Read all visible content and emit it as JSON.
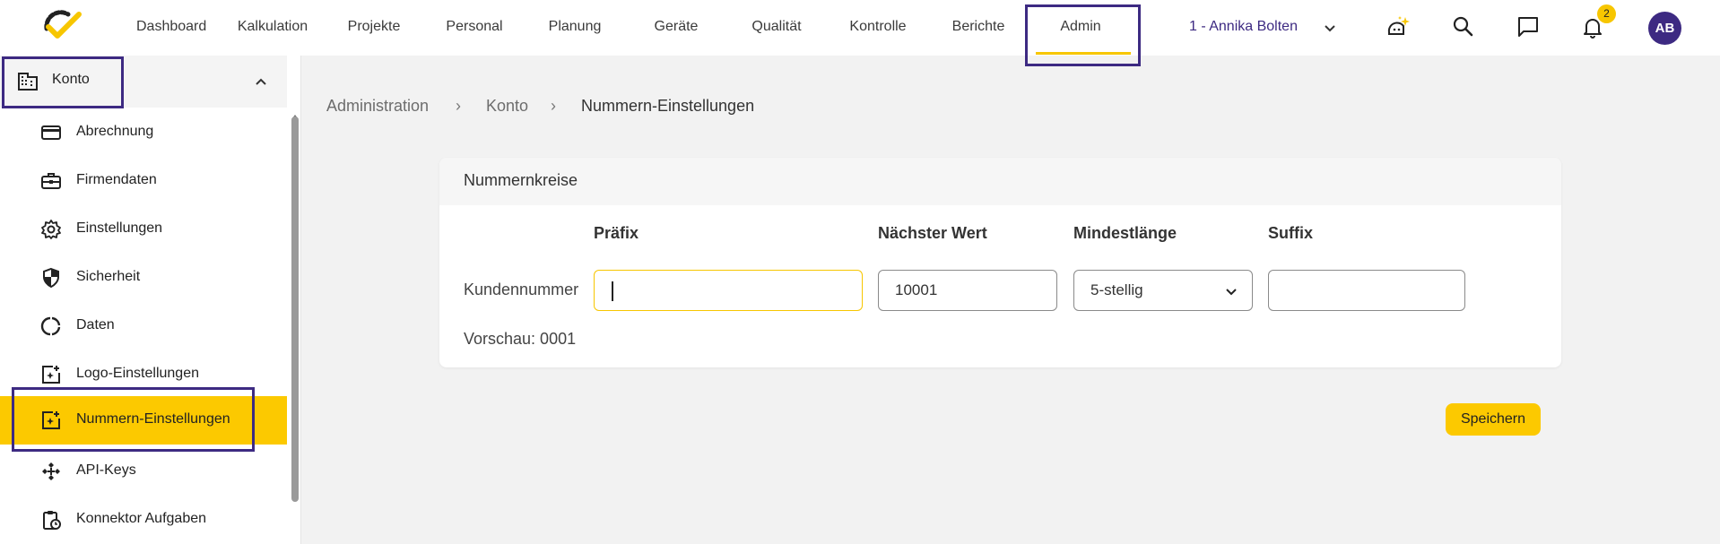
{
  "nav": {
    "items": [
      "Dashboard",
      "Kalkulation",
      "Projekte",
      "Personal",
      "Planung",
      "Geräte",
      "Qualität",
      "Kontrolle",
      "Berichte",
      "Admin"
    ],
    "active": "Admin",
    "user": "1 - Annika Bolten",
    "notification_count": "2",
    "avatar_initials": "AB",
    "icons": [
      "ai-assistant-icon",
      "search-icon",
      "chat-icon",
      "bell-icon"
    ]
  },
  "sidebar": {
    "section": "Konto",
    "items": [
      {
        "label": "Abrechnung",
        "icon": "credit-card-icon"
      },
      {
        "label": "Firmendaten",
        "icon": "briefcase-icon"
      },
      {
        "label": "Einstellungen",
        "icon": "gear-icon"
      },
      {
        "label": "Sicherheit",
        "icon": "shield-icon"
      },
      {
        "label": "Daten",
        "icon": "data-ring-icon"
      },
      {
        "label": "Logo-Einstellungen",
        "icon": "image-add-icon"
      },
      {
        "label": "Nummern-Einstellungen",
        "icon": "image-add-icon"
      },
      {
        "label": "API-Keys",
        "icon": "api-icon"
      },
      {
        "label": "Konnektor Aufgaben",
        "icon": "clipboard-icon"
      }
    ],
    "active_item": "Nummern-Einstellungen"
  },
  "breadcrumb": [
    "Administration",
    "Konto",
    "Nummern-Einstellungen"
  ],
  "card": {
    "title": "Nummernkreise",
    "columns": [
      "Präfix",
      "Nächster Wert",
      "Mindestlänge",
      "Suffix"
    ],
    "row": {
      "label": "Kundennummer",
      "prefix": "",
      "next_value": "10001",
      "min_length": "5-stellig",
      "suffix": ""
    },
    "preview": "Vorschau: 0001"
  },
  "actions": {
    "save": "Speichern"
  },
  "colors": {
    "accent": "#fcc900",
    "brand": "#3d2a82",
    "background": "#f2f2f2"
  }
}
